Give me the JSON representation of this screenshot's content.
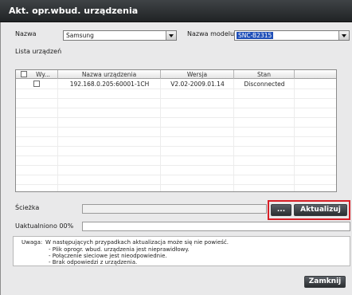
{
  "window": {
    "title": "Akt. opr.wbud. urządzenia"
  },
  "filters": {
    "name_label": "Nazwa",
    "name_value": "Samsung",
    "model_label": "Nazwa modelu",
    "model_value": "SNC-B2315"
  },
  "device_list": {
    "label": "Lista urządzeń",
    "columns": [
      "Wy...",
      "Nazwa urządzenia",
      "Wersja",
      "Stan"
    ],
    "rows": [
      {
        "checked": false,
        "device_name": "192.168.0.205:60001-1CH",
        "version": "V2.02-2009.01.14",
        "status": "Disconnected"
      }
    ]
  },
  "path": {
    "label": "Ścieżka",
    "value": ""
  },
  "browse_button": {
    "label": "..."
  },
  "update_button": {
    "label": "Aktualizuj"
  },
  "progress": {
    "label": "Uaktualniono 00%",
    "percent": 0
  },
  "notice": {
    "heading": "Uwaga:",
    "text": "W następujących przypadkach aktualizacja może się nie powieść.",
    "items": [
      "- Plik oprogr. wbud. urządzenia jest nieprawidłowy.",
      "- Połączenie sieciowe jest nieodpowiednie.",
      "- Brak odpowiedzi z urządzenia."
    ]
  },
  "close_button": {
    "label": "Zamknij"
  },
  "colors": {
    "titlebar": "#2a2d30",
    "selection": "#1f4fb8",
    "highlight": "#d81e26"
  }
}
